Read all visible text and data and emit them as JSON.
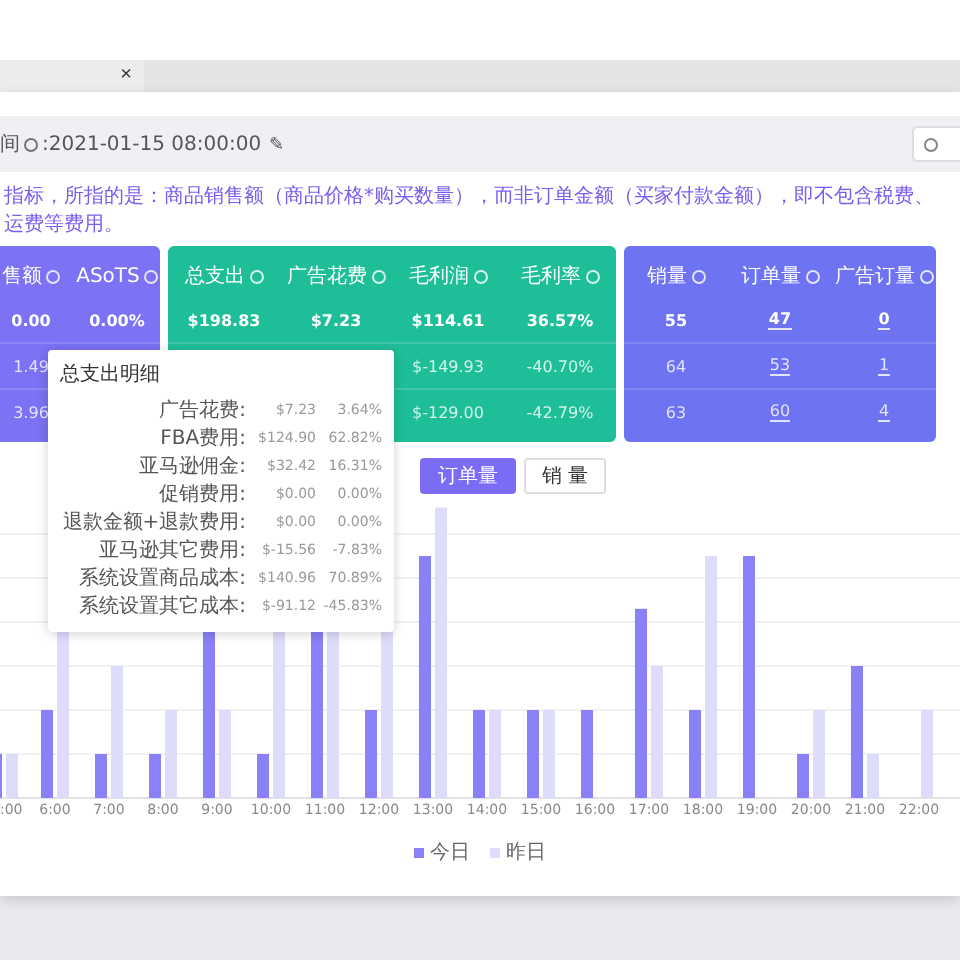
{
  "tab": {
    "close": "×"
  },
  "time_bar": {
    "label": "间",
    "value": ":2021-01-15 08:00:00",
    "edit": "✎"
  },
  "notice": "指标，所指的是：商品销售额（商品价格*购买数量），而非订单金额（买家付款金额），即不包含税费、运费等费用。",
  "cards": [
    {
      "color": "#7b72f4",
      "columns": [
        {
          "title": "售额",
          "kind": "plain"
        },
        {
          "title": "ASoTS",
          "kind": "plain"
        }
      ],
      "rows": [
        [
          "0.00",
          "0.00%"
        ],
        [
          "1.49",
          null
        ],
        [
          "3.96",
          null
        ]
      ]
    },
    {
      "color": "#1ebf98",
      "columns": [
        {
          "title": "总支出",
          "kind": "plain"
        },
        {
          "title": "广告花费",
          "kind": "plain"
        },
        {
          "title": "毛利润",
          "kind": "plain"
        },
        {
          "title": "毛利率",
          "kind": "plain"
        }
      ],
      "rows": [
        [
          "$198.83",
          "$7.23",
          "$114.61",
          "36.57%"
        ],
        [
          null,
          null,
          "$-149.93",
          "-40.70%"
        ],
        [
          null,
          null,
          "$-129.00",
          "-42.79%"
        ]
      ]
    },
    {
      "color": "#6e73f2",
      "columns": [
        {
          "title": "销量",
          "kind": "plain"
        },
        {
          "title": "订单量",
          "kind": "link"
        },
        {
          "title": "广告订量",
          "kind": "link"
        }
      ],
      "rows": [
        [
          "55",
          "47",
          "0"
        ],
        [
          "64",
          "53",
          "1"
        ],
        [
          "63",
          "60",
          "4"
        ]
      ]
    }
  ],
  "tooltip": {
    "title": "总支出明细",
    "rows": [
      {
        "label": "广告花费:",
        "amount": "$7.23",
        "share": "3.64%"
      },
      {
        "label": "FBA费用:",
        "amount": "$124.90",
        "share": "62.82%"
      },
      {
        "label": "亚马逊佣金:",
        "amount": "$32.42",
        "share": "16.31%"
      },
      {
        "label": "促销费用:",
        "amount": "$0.00",
        "share": "0.00%"
      },
      {
        "label": "退款金额+退款费用:",
        "amount": "$0.00",
        "share": "0.00%"
      },
      {
        "label": "亚马逊其它费用:",
        "amount": "$-15.56",
        "share": "-7.83%"
      },
      {
        "label": "系统设置商品成本:",
        "amount": "$140.96",
        "share": "70.89%"
      },
      {
        "label": "系统设置其它成本:",
        "amount": "$-91.12",
        "share": "-45.83%"
      }
    ]
  },
  "chart": {
    "buttons": [
      {
        "label": "订单量",
        "selected": true
      },
      {
        "label": "销 量",
        "selected": false
      }
    ],
    "x_labels": [
      ":00",
      "6:00",
      "7:00",
      "8:00",
      "9:00",
      "10:00",
      "11:00",
      "12:00",
      "13:00",
      "14:00",
      "15:00",
      "16:00",
      "17:00",
      "18:00",
      "19:00",
      "20:00",
      "21:00",
      "22:00"
    ],
    "legend": [
      {
        "label": "今日",
        "color": "#8a80f7"
      },
      {
        "label": "昨日",
        "color": "#dedcfb"
      }
    ]
  }
}
